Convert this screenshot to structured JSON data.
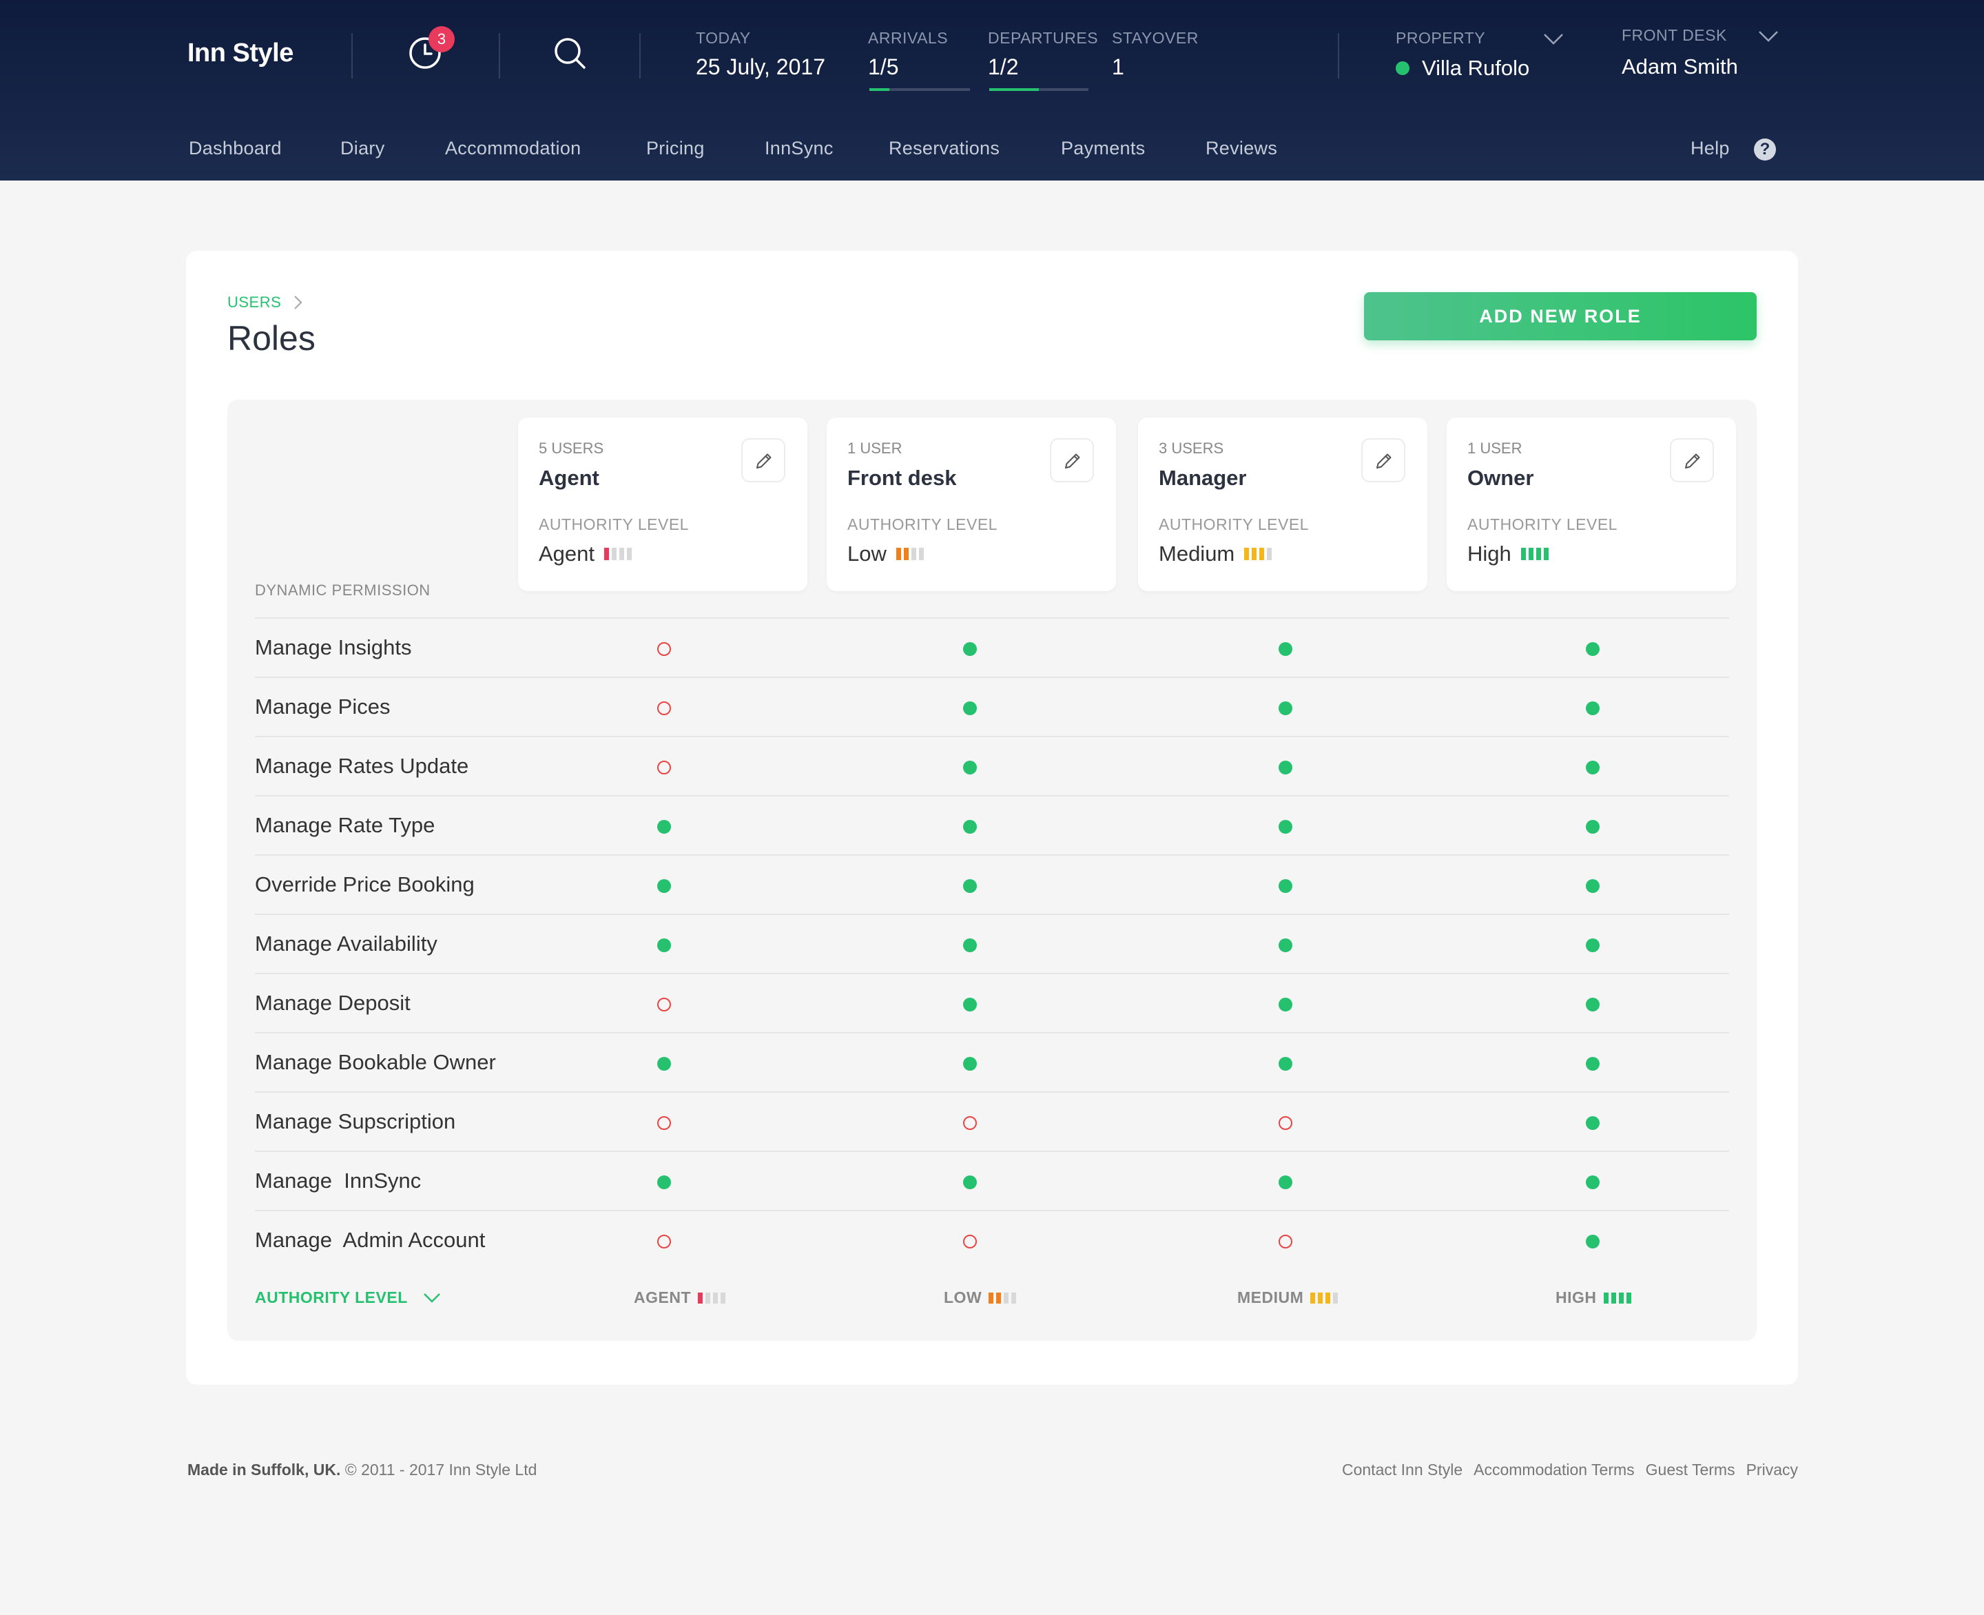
{
  "app": {
    "brand": "Inn Style",
    "notification_count": "3"
  },
  "header": {
    "today": {
      "label": "TODAY",
      "value": "25 July, 2017"
    },
    "arrivals": {
      "label": "ARRIVALS",
      "value": "1/5",
      "progress": 0.2
    },
    "departures": {
      "label": "DEPARTURES",
      "value": "1/2",
      "progress": 0.5
    },
    "stayover": {
      "label": "STAYOVER",
      "value": "1"
    },
    "property": {
      "label": "PROPERTY",
      "value": "Villa Rufolo",
      "status_color": "#25c16f"
    },
    "front_desk": {
      "label": "FRONT DESK",
      "value": "Adam Smith"
    }
  },
  "nav": {
    "items": [
      "Dashboard",
      "Diary",
      "Accommodation",
      "Pricing",
      "InnSync",
      "Reservations",
      "Payments",
      "Reviews"
    ],
    "help": "Help"
  },
  "page": {
    "breadcrumb": "USERS",
    "title": "Roles",
    "add_button": "ADD NEW ROLE",
    "dynamic_permission_label": "DYNAMIC PERMISSION",
    "authority_level_toggle": "AUTHORITY LEVEL"
  },
  "roles": [
    {
      "users": "5 USERS",
      "name": "Agent",
      "authority_label": "AUTHORITY LEVEL",
      "authority": "Agent",
      "footer_label": "AGENT",
      "level": 1,
      "color": "#e73a5d"
    },
    {
      "users": "1 USER",
      "name": "Front desk",
      "authority_label": "AUTHORITY LEVEL",
      "authority": "Low",
      "footer_label": "LOW",
      "level": 2,
      "color": "#f07f1e"
    },
    {
      "users": "3 USERS",
      "name": "Manager",
      "authority_label": "AUTHORITY LEVEL",
      "authority": "Medium",
      "footer_label": "MEDIUM",
      "level": 3,
      "color": "#f4b619"
    },
    {
      "users": "1 USER",
      "name": "Owner",
      "authority_label": "AUTHORITY LEVEL",
      "authority": "High",
      "footer_label": "HIGH",
      "level": 4,
      "color": "#25c16f"
    }
  ],
  "permissions": [
    {
      "name": "Manage Insights",
      "grants": [
        false,
        true,
        true,
        true
      ]
    },
    {
      "name": "Manage Pices",
      "grants": [
        false,
        true,
        true,
        true
      ]
    },
    {
      "name": "Manage Rates Update",
      "grants": [
        false,
        true,
        true,
        true
      ]
    },
    {
      "name": "Manage Rate Type",
      "grants": [
        true,
        true,
        true,
        true
      ]
    },
    {
      "name": "Override Price Booking",
      "grants": [
        true,
        true,
        true,
        true
      ]
    },
    {
      "name": "Manage Availability",
      "grants": [
        true,
        true,
        true,
        true
      ]
    },
    {
      "name": "Manage Deposit",
      "grants": [
        false,
        true,
        true,
        true
      ]
    },
    {
      "name": "Manage Bookable Owner",
      "grants": [
        true,
        true,
        true,
        true
      ]
    },
    {
      "name": "Manage Supscription",
      "grants": [
        false,
        false,
        false,
        true
      ]
    },
    {
      "name": "Manage  InnSync",
      "grants": [
        true,
        true,
        true,
        true
      ]
    },
    {
      "name": "Manage  Admin Account",
      "grants": [
        false,
        false,
        false,
        true
      ]
    }
  ],
  "footer": {
    "made_in": "Made in Suffolk, UK.",
    "copyright": "© 2011 - 2017 Inn Style Ltd",
    "links": [
      "Contact Inn Style",
      "Accommodation Terms",
      "Guest Terms",
      "Privacy"
    ]
  }
}
